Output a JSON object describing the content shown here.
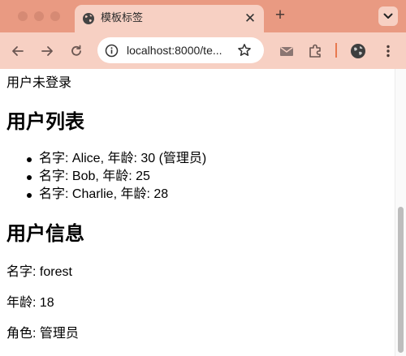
{
  "browser": {
    "tab_title": "模板标签",
    "url": "localhost:8000/te...",
    "new_tab_symbol": "+",
    "close_symbol": "✕"
  },
  "page": {
    "login_status": "用户未登录",
    "user_list_heading": "用户列表",
    "users": [
      "名字: Alice, 年龄: 30 (管理员)",
      "名字: Bob, 年龄: 25",
      "名字: Charlie, 年龄: 28"
    ],
    "user_info_heading": "用户信息",
    "info": {
      "name": "名字: forest",
      "age": "年龄: 18",
      "role": "角色: 管理员"
    }
  },
  "colors": {
    "titlebar": "#e99a82",
    "toolbar": "#f7d0c3",
    "accent": "#e8794f"
  }
}
